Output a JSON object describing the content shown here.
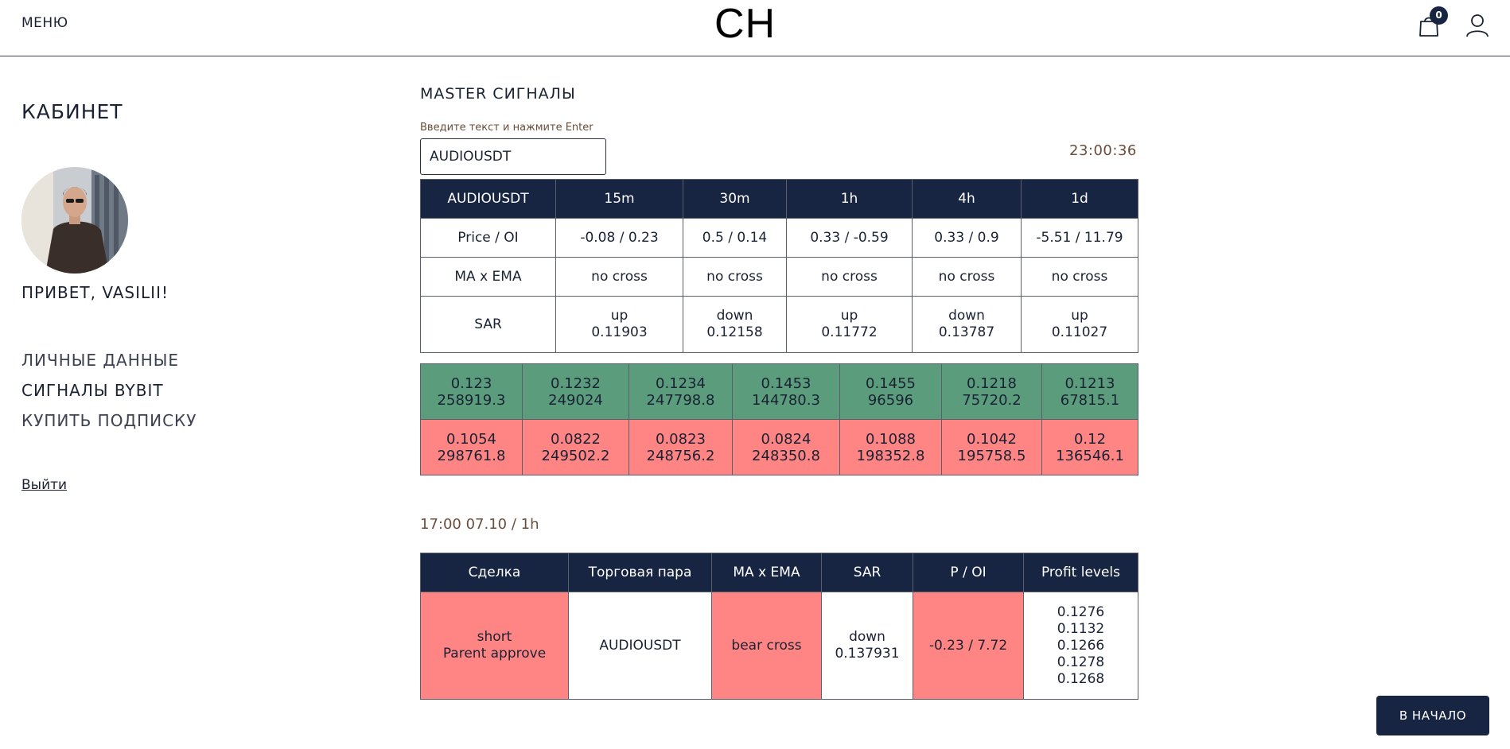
{
  "header": {
    "menu_label": "МЕНЮ",
    "logo": "CH",
    "cart_count": "0"
  },
  "sidebar": {
    "title": "КАБИНЕТ",
    "greeting": "ПРИВЕТ, VASILII!",
    "items": [
      {
        "label": "ЛИЧНЫЕ ДАННЫЕ",
        "active": false
      },
      {
        "label": "СИГНАЛЫ BYBIT",
        "active": true
      },
      {
        "label": "КУПИТЬ ПОДПИСКУ",
        "active": false
      }
    ],
    "logout_label": "Выйти"
  },
  "main": {
    "title": "MASTER СИГНАЛЫ",
    "input_hint": "Введите текст и нажмите Enter",
    "input_value": "AUDIOUSDT",
    "clock": "23:00:36",
    "indicators": {
      "headers": [
        "AUDIOUSDT",
        "15m",
        "30m",
        "1h",
        "4h",
        "1d"
      ],
      "price_oi": {
        "label": "Price / OI",
        "values": [
          "-0.08 / 0.23",
          "0.5 / 0.14",
          "0.33 / -0.59",
          "0.33 / 0.9",
          "-5.51 / 11.79"
        ]
      },
      "ma_ema": {
        "label": "MA x EMA",
        "values": [
          "no cross",
          "no cross",
          "no cross",
          "no cross",
          "no cross"
        ]
      },
      "sar": {
        "label": "SAR",
        "values": [
          {
            "dir": "up",
            "value": "0.11903"
          },
          {
            "dir": "down",
            "value": "0.12158"
          },
          {
            "dir": "up",
            "value": "0.11772"
          },
          {
            "dir": "down",
            "value": "0.13787"
          },
          {
            "dir": "up",
            "value": "0.11027"
          }
        ]
      }
    },
    "levels": {
      "green": [
        {
          "price": "0.123",
          "volume": "258919.3"
        },
        {
          "price": "0.1232",
          "volume": "249024"
        },
        {
          "price": "0.1234",
          "volume": "247798.8"
        },
        {
          "price": "0.1453",
          "volume": "144780.3"
        },
        {
          "price": "0.1455",
          "volume": "96596"
        },
        {
          "price": "0.1218",
          "volume": "75720.2"
        },
        {
          "price": "0.1213",
          "volume": "67815.1"
        }
      ],
      "red": [
        {
          "price": "0.1054",
          "volume": "298761.8"
        },
        {
          "price": "0.0822",
          "volume": "249502.2"
        },
        {
          "price": "0.0823",
          "volume": "248756.2"
        },
        {
          "price": "0.0824",
          "volume": "248350.8"
        },
        {
          "price": "0.1088",
          "volume": "198352.8"
        },
        {
          "price": "0.1042",
          "volume": "195758.5"
        },
        {
          "price": "0.12",
          "volume": "136546.1"
        }
      ]
    },
    "signal_time": "17:00 07.10 / 1h",
    "trades": {
      "headers": [
        "Сделка",
        "Торговая пара",
        "MA x EMA",
        "SAR",
        "P / OI",
        "Profit levels"
      ],
      "row": {
        "deal_type": "short",
        "deal_note": "Parent approve",
        "pair": "AUDIOUSDT",
        "ma_ema": "bear cross",
        "sar_dir": "down",
        "sar_value": "0.137931",
        "p_oi": "-0.23 / 7.72",
        "profit_levels": [
          "0.1276",
          "0.1132",
          "0.1266",
          "0.1278",
          "0.1268"
        ]
      }
    }
  },
  "top_button_label": "В НАЧАЛО",
  "colors": {
    "navy": "#172542",
    "green": "#5a9c7c",
    "red": "#ff8484",
    "accent_brown": "#6b4d3a"
  }
}
